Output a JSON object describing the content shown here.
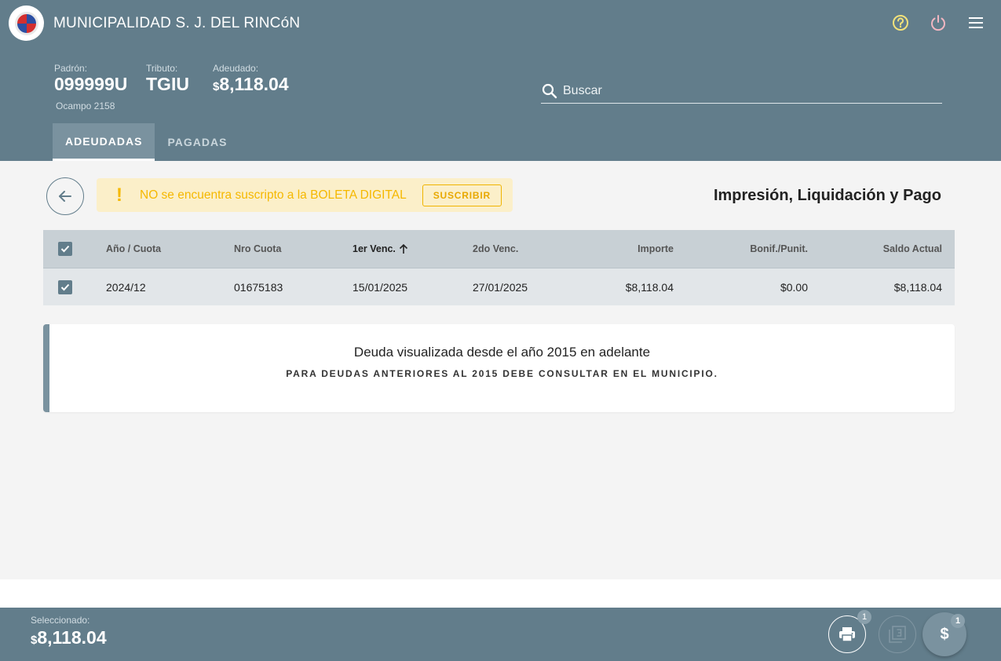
{
  "header": {
    "title": "MUNICIPALIDAD S. J. DEL RINCóN",
    "padron_label": "Padrón:",
    "padron_value": "099999U",
    "tributo_label": "Tributo:",
    "tributo_value": "TGIU",
    "adeudado_label": "Adeudado:",
    "adeudado_currency": "$",
    "adeudado_value": "8,118.04",
    "address": "Ocampo 2158",
    "search_placeholder": "Buscar"
  },
  "tabs": [
    {
      "label": "ADEUDADAS",
      "active": true
    },
    {
      "label": "PAGADAS",
      "active": false
    }
  ],
  "alert": {
    "text": "NO se encuentra suscripto a la BOLETA DIGITAL",
    "button": "SUSCRIBIR"
  },
  "section_title": "Impresión, Liquidación y Pago",
  "table": {
    "columns": [
      "Año / Cuota",
      "Nro Cuota",
      "1er Venc.",
      "2do Venc.",
      "Importe",
      "Bonif./Punit.",
      "Saldo Actual"
    ],
    "rows": [
      {
        "anio_cuota": "2024/12",
        "nro_cuota": "01675183",
        "venc1": "15/01/2025",
        "venc2": "27/01/2025",
        "importe": "$8,118.04",
        "bonif": "$0.00",
        "saldo": "$8,118.04"
      }
    ]
  },
  "notice": {
    "main": "Deuda visualizada desde el año 2015 en adelante",
    "sub": "PARA DEUDAS ANTERIORES AL 2015 DEBE CONSULTAR EN EL MUNICIPIO."
  },
  "footer": {
    "selected_label": "Seleccionado:",
    "selected_currency": "$",
    "selected_value": "8,118.04",
    "print_badge": "1",
    "pay_badge": "1",
    "pay_symbol": "$"
  },
  "colors": {
    "primary": "#627d8b",
    "warning": "#f5b800",
    "help_icon": "#f3e27a",
    "power_icon": "#f1b6c1"
  }
}
